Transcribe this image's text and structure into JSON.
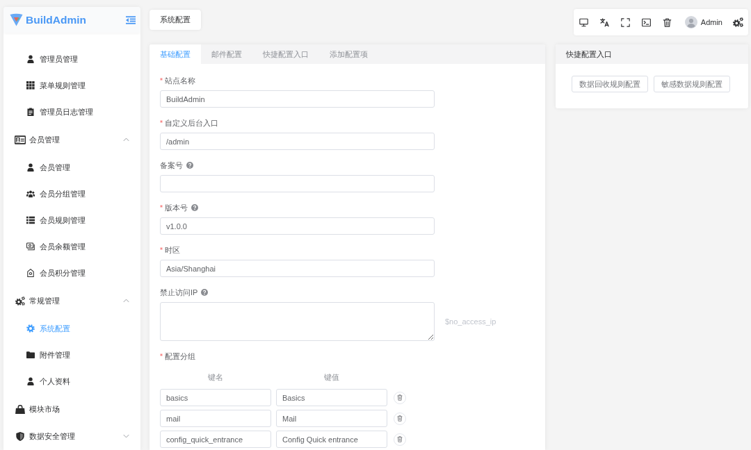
{
  "sidebar": {
    "logo": "BuildAdmin",
    "menu": [
      {
        "kind": "group",
        "children": [
          {
            "label": "管理员管理",
            "selected": false
          },
          {
            "label": "菜单规则管理",
            "selected": false
          },
          {
            "label": "管理员日志管理",
            "selected": false
          }
        ]
      },
      {
        "kind": "group",
        "label": "会员管理",
        "expanded": true,
        "children": [
          {
            "label": "会员管理",
            "selected": false
          },
          {
            "label": "会员分组管理",
            "selected": false
          },
          {
            "label": "会员规则管理",
            "selected": false
          },
          {
            "label": "会员余额管理",
            "selected": false
          },
          {
            "label": "会员积分管理",
            "selected": false
          }
        ]
      },
      {
        "kind": "group",
        "label": "常规管理",
        "expanded": true,
        "children": [
          {
            "label": "系统配置",
            "selected": true
          },
          {
            "label": "附件管理",
            "selected": false
          },
          {
            "label": "个人资料",
            "selected": false
          }
        ]
      },
      {
        "kind": "item",
        "label": "模块市场",
        "selected": false
      },
      {
        "kind": "group",
        "label": "数据安全管理",
        "expanded": false
      }
    ]
  },
  "page_tabs": [
    {
      "label": "系统配置"
    }
  ],
  "toolbar": {
    "user": "Admin"
  },
  "config_card": {
    "tabs": [
      {
        "label": "基础配置",
        "selected": true
      },
      {
        "label": "邮件配置",
        "selected": false
      },
      {
        "label": "快捷配置入口",
        "selected": false
      },
      {
        "label": "添加配置项",
        "selected": false
      }
    ],
    "fields": [
      {
        "kind": "input",
        "label": "站点名称",
        "required": true,
        "help": false,
        "value": "BuildAdmin"
      },
      {
        "kind": "input",
        "label": "自定义后台入口",
        "required": true,
        "help": false,
        "value": "/admin"
      },
      {
        "kind": "input",
        "label": "备案号",
        "required": false,
        "help": true
      },
      {
        "kind": "input",
        "label": "版本号",
        "required": true,
        "help": true,
        "value": "v1.0.0"
      },
      {
        "kind": "input",
        "label": "时区",
        "required": true,
        "help": false,
        "value": "Asia/Shanghai"
      },
      {
        "kind": "textarea",
        "label": "禁止访问IP",
        "required": false,
        "help": true,
        "tip": "$no_access_ip"
      }
    ],
    "group": {
      "label": "配置分组",
      "required": true,
      "columns": [
        "键名",
        "键值"
      ],
      "rows": [
        {
          "key": "basics",
          "value": "Basics"
        },
        {
          "key": "mail",
          "value": "Mail"
        },
        {
          "key": "config_quick_entrance",
          "value": "Config Quick entrance"
        }
      ]
    }
  },
  "quick_card": {
    "title": "快捷配置入口",
    "buttons": [
      "数据回收规则配置",
      "敏感数据规则配置"
    ]
  }
}
